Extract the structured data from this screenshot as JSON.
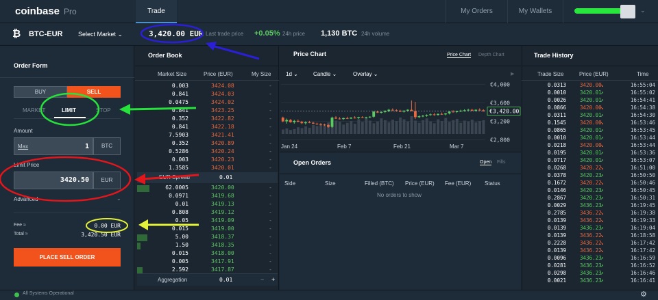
{
  "app": {
    "logo": "coinbase",
    "logo_suffix": "Pro"
  },
  "nav": {
    "trade": "Trade",
    "my_orders": "My Orders",
    "my_wallets": "My Wallets"
  },
  "ticker": {
    "pair": "BTC-EUR",
    "select_market": "Select Market",
    "last_price": "3,420.00 EUR",
    "last_price_label": "Last trade price",
    "change": "+0.05%",
    "change_label": "24h price",
    "volume": "1,130 BTC",
    "volume_label": "24h volume"
  },
  "order_form": {
    "title": "Order Form",
    "buy": "BUY",
    "sell": "SELL",
    "types": [
      "MARKET",
      "LIMIT",
      "STOP"
    ],
    "amount_label": "Amount",
    "max": "Max",
    "amount_value": "1",
    "amount_unit": "BTC",
    "limit_label": "Limit Price",
    "limit_value": "3420.50",
    "limit_unit": "EUR",
    "advanced": "Advanced",
    "fee_label": "Fee ≈",
    "fee_value": "0.00 EUR",
    "total_label": "Total ≈",
    "total_value": "3,420.50 EUR",
    "place": "PLACE SELL ORDER"
  },
  "order_book": {
    "title": "Order Book",
    "headers": [
      "Market Size",
      "Price (EUR)",
      "My Size"
    ],
    "asks": [
      {
        "size": "0.003",
        "price": "3424.08"
      },
      {
        "size": "0.841",
        "price": "3424.03"
      },
      {
        "size": "0.0475",
        "price": "3424.02"
      },
      {
        "size": "0.841",
        "price": "3423.25"
      },
      {
        "size": "0.352",
        "price": "3422.82"
      },
      {
        "size": "0.841",
        "price": "3422.18"
      },
      {
        "size": "7.5903",
        "price": "3421.41"
      },
      {
        "size": "0.352",
        "price": "3420.89"
      },
      {
        "size": "0.5286",
        "price": "3420.24"
      },
      {
        "size": "0.003",
        "price": "3420.23"
      },
      {
        "size": "1.3585",
        "price": "3420.01"
      }
    ],
    "spread_label": "EUR Spread",
    "spread_value": "0.01",
    "bids": [
      {
        "size": "62.0005",
        "price": "3420.00"
      },
      {
        "size": "0.0971",
        "price": "3419.68"
      },
      {
        "size": "0.01",
        "price": "3419.13"
      },
      {
        "size": "0.808",
        "price": "3419.12"
      },
      {
        "size": "0.05",
        "price": "3419.09"
      },
      {
        "size": "0.015",
        "price": "3419.00"
      },
      {
        "size": "5.00",
        "price": "3418.37"
      },
      {
        "size": "1.50",
        "price": "3418.35"
      },
      {
        "size": "0.015",
        "price": "3418.00"
      },
      {
        "size": "0.005",
        "price": "3417.91"
      },
      {
        "size": "2.592",
        "price": "3417.87"
      }
    ],
    "my_size_placeholder": "-",
    "aggregation_label": "Aggregation",
    "aggregation_value": "0.01",
    "minus": "−",
    "plus": "+"
  },
  "price_chart": {
    "title": "Price Chart",
    "tab_price": "Price Chart",
    "tab_depth": "Depth Chart",
    "interval": "1d",
    "style": "Candle",
    "overlay": "Overlay"
  },
  "chart_data": {
    "type": "candlestick",
    "x_tick_labels": [
      "Jan 24",
      "Feb 7",
      "Feb 21",
      "Mar 7"
    ],
    "y_tick_labels": [
      "€4,000",
      "€3,600",
      "€3,200",
      "€2,800"
    ],
    "last_price_label": "€3,420.00",
    "ylim": [
      2750,
      4050
    ],
    "candles": [
      [
        3280,
        3300,
        3180,
        3200
      ],
      [
        3200,
        3260,
        3150,
        3230
      ],
      [
        3230,
        3250,
        3170,
        3180
      ],
      [
        3180,
        3230,
        3150,
        3210
      ],
      [
        3210,
        3240,
        3180,
        3190
      ],
      [
        3190,
        3210,
        3140,
        3160
      ],
      [
        3160,
        3200,
        3130,
        3180
      ],
      [
        3180,
        3210,
        3160,
        3170
      ],
      [
        3170,
        3190,
        3140,
        3150
      ],
      [
        3150,
        3170,
        3120,
        3140
      ],
      [
        3140,
        3160,
        3110,
        3130
      ],
      [
        3130,
        3150,
        3100,
        3120
      ],
      [
        3120,
        3140,
        3060,
        3080
      ],
      [
        3080,
        3300,
        3060,
        3280
      ],
      [
        3280,
        3310,
        3250,
        3260
      ],
      [
        3260,
        3290,
        3240,
        3250
      ],
      [
        3250,
        3280,
        3230,
        3270
      ],
      [
        3270,
        3300,
        3250,
        3260
      ],
      [
        3260,
        3290,
        3250,
        3280
      ],
      [
        3280,
        3310,
        3260,
        3270
      ],
      [
        3270,
        3300,
        3250,
        3290
      ],
      [
        3290,
        3310,
        3270,
        3280
      ],
      [
        3280,
        3300,
        3260,
        3290
      ],
      [
        3290,
        3310,
        3270,
        3300
      ],
      [
        3300,
        3420,
        3280,
        3410
      ],
      [
        3410,
        3430,
        3380,
        3390
      ],
      [
        3390,
        3420,
        3370,
        3400
      ],
      [
        3400,
        3440,
        3380,
        3420
      ],
      [
        3420,
        3470,
        3400,
        3450
      ],
      [
        3450,
        3480,
        3420,
        3440
      ],
      [
        3440,
        3460,
        3410,
        3430
      ],
      [
        3430,
        3450,
        3400,
        3410
      ],
      [
        3410,
        3440,
        3390,
        3430
      ],
      [
        3430,
        3460,
        3410,
        3450
      ],
      [
        3450,
        3650,
        3430,
        3420
      ],
      [
        3420,
        3620,
        3250,
        3290
      ],
      [
        3290,
        3330,
        3270,
        3310
      ],
      [
        3310,
        3340,
        3290,
        3320
      ],
      [
        3320,
        3350,
        3300,
        3340
      ],
      [
        3340,
        3370,
        3320,
        3350
      ],
      [
        3350,
        3380,
        3320,
        3340
      ],
      [
        3340,
        3370,
        3320,
        3360
      ],
      [
        3360,
        3390,
        3340,
        3350
      ],
      [
        3350,
        3380,
        3330,
        3370
      ],
      [
        3370,
        3420,
        3350,
        3410
      ],
      [
        3410,
        3440,
        3390,
        3400
      ],
      [
        3400,
        3430,
        3380,
        3420
      ],
      [
        3420,
        3450,
        3400,
        3430
      ],
      [
        3430,
        3460,
        3410,
        3440
      ],
      [
        3440,
        3470,
        3420,
        3450
      ],
      [
        3450,
        3470,
        3420,
        3430
      ],
      [
        3430,
        3460,
        3410,
        3450
      ],
      [
        3450,
        3480,
        3430,
        3440
      ],
      [
        3440,
        3460,
        3410,
        3420
      ]
    ],
    "volumes": [
      20,
      25,
      18,
      22,
      30,
      26,
      34,
      28,
      40,
      36,
      45,
      38,
      52,
      48,
      60,
      55,
      42,
      50,
      58,
      46,
      66,
      54,
      72,
      60,
      48,
      56,
      70,
      62,
      52,
      64,
      58,
      74,
      66,
      56,
      80,
      60,
      50,
      62,
      70,
      56,
      48,
      66,
      58,
      72,
      54,
      62,
      68,
      50,
      60,
      56,
      64,
      52,
      58,
      62
    ]
  },
  "open_orders": {
    "title": "Open Orders",
    "tab_open": "Open",
    "tab_fills": "Fills",
    "headers": [
      "Side",
      "Size",
      "Filled (BTC)",
      "Price (EUR)",
      "Fee (EUR)",
      "Status"
    ],
    "empty": "No orders to show"
  },
  "trade_history": {
    "title": "Trade History",
    "headers": [
      "Trade Size",
      "Price (EUR)",
      "Time"
    ],
    "trades": [
      {
        "size": "0.0313",
        "price": "3420.00",
        "dir": "down",
        "time": "16:55:04"
      },
      {
        "size": "0.0010",
        "price": "3420.01",
        "dir": "up",
        "time": "16:55:02"
      },
      {
        "size": "0.0026",
        "price": "3420.01",
        "dir": "up",
        "time": "16:54:41"
      },
      {
        "size": "0.0866",
        "price": "3420.00",
        "dir": "down",
        "time": "16:54:38"
      },
      {
        "size": "0.0311",
        "price": "3420.01",
        "dir": "up",
        "time": "16:54:30"
      },
      {
        "size": "0.1545",
        "price": "3420.00",
        "dir": "down",
        "time": "16:53:46"
      },
      {
        "size": "0.0865",
        "price": "3420.01",
        "dir": "up",
        "time": "16:53:45"
      },
      {
        "size": "0.0010",
        "price": "3420.01",
        "dir": "up",
        "time": "16:53:44"
      },
      {
        "size": "0.0218",
        "price": "3420.00",
        "dir": "down",
        "time": "16:53:44"
      },
      {
        "size": "0.0195",
        "price": "3420.01",
        "dir": "up",
        "time": "16:53:36"
      },
      {
        "size": "0.0717",
        "price": "3420.01",
        "dir": "up",
        "time": "16:53:07"
      },
      {
        "size": "0.0268",
        "price": "3420.22",
        "dir": "down",
        "time": "16:51:00"
      },
      {
        "size": "0.0378",
        "price": "3420.23",
        "dir": "up",
        "time": "16:50:50"
      },
      {
        "size": "0.1672",
        "price": "3420.22",
        "dir": "down",
        "time": "16:50:46"
      },
      {
        "size": "0.0146",
        "price": "3420.23",
        "dir": "up",
        "time": "16:50:45"
      },
      {
        "size": "0.2867",
        "price": "3420.23",
        "dir": "up",
        "time": "16:50:31"
      },
      {
        "size": "0.0029",
        "price": "3436.23",
        "dir": "up",
        "time": "16:19:45"
      },
      {
        "size": "0.2785",
        "price": "3436.22",
        "dir": "down",
        "time": "16:19:38"
      },
      {
        "size": "0.0139",
        "price": "3436.22",
        "dir": "down",
        "time": "16:19:33"
      },
      {
        "size": "0.0139",
        "price": "3436.23",
        "dir": "up",
        "time": "16:19:04"
      },
      {
        "size": "0.0139",
        "price": "3436.22",
        "dir": "down",
        "time": "16:18:58"
      },
      {
        "size": "0.2228",
        "price": "3436.22",
        "dir": "down",
        "time": "16:17:42"
      },
      {
        "size": "0.0139",
        "price": "3436.22",
        "dir": "down",
        "time": "16:17:42"
      },
      {
        "size": "0.0096",
        "price": "3436.23",
        "dir": "up",
        "time": "16:16:59"
      },
      {
        "size": "0.0281",
        "price": "3436.23",
        "dir": "up",
        "time": "16:16:52"
      },
      {
        "size": "0.0298",
        "price": "3436.23",
        "dir": "up",
        "time": "16:16:46"
      },
      {
        "size": "0.0021",
        "price": "3436.23",
        "dir": "up",
        "time": "16:16:41"
      }
    ]
  },
  "status": {
    "text": "All Systems Operational"
  },
  "colors": {
    "sell": "#f2531d",
    "up": "#5bcb5f",
    "down": "#e8693f",
    "bg": "#1b2631",
    "panel": "#1e2b38"
  },
  "icons": {
    "bitcoin": "bitcoin-icon",
    "gear": "gear-icon",
    "caret": "chevron-down-icon"
  }
}
